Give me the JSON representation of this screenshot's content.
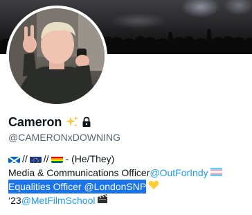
{
  "profile": {
    "display_name": "Cameron",
    "handle": "@CAMERONxDOWNING",
    "name_emoji": "sparkles-icon",
    "protected_icon": "lock-icon"
  },
  "bio": {
    "line1": {
      "flags": [
        "scotland-flag-icon",
        "eu-flag-icon",
        "rainbow-flag-icon"
      ],
      "separator": "//",
      "pronouns": "- (He/They)"
    },
    "line2": {
      "text": "Media & Communications Officer ",
      "mention": "@OutForIndy",
      "emoji": "transgender-flag-icon"
    },
    "line3": {
      "text": "Equalities Officer ",
      "mention": "@LondonSNP",
      "emoji": "yellow-heart-icon"
    },
    "line4": {
      "text": "‘23 ",
      "mention": "@MetFilmSchool",
      "emoji": "clapper-board-icon"
    }
  },
  "colors": {
    "link": "#1d9bf0",
    "selection": "#1a73e8",
    "secondary_text": "#536471"
  }
}
